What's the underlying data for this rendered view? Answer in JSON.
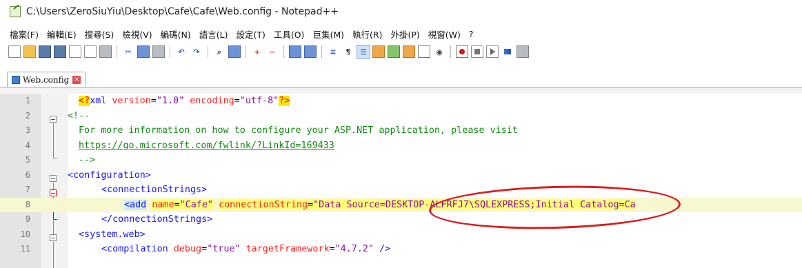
{
  "window": {
    "title": "C:\\Users\\ZeroSiuYiu\\Desktop\\Cafe\\Cafe\\Web.config - Notepad++"
  },
  "menu": {
    "items": [
      {
        "label": "檔案(F)"
      },
      {
        "label": "編輯(E)"
      },
      {
        "label": "搜尋(S)"
      },
      {
        "label": "檢視(V)"
      },
      {
        "label": "編碼(N)"
      },
      {
        "label": "語言(L)"
      },
      {
        "label": "設定(T)"
      },
      {
        "label": "工具(O)"
      },
      {
        "label": "巨集(M)"
      },
      {
        "label": "執行(R)"
      },
      {
        "label": "外掛(P)"
      },
      {
        "label": "視窗(W)"
      },
      {
        "label": "?"
      }
    ]
  },
  "toolbar": {
    "icons": [
      "new-file-icon",
      "open-file-icon",
      "save-icon",
      "save-all-icon",
      "close-icon",
      "close-all-icon",
      "print-icon",
      "cut-icon",
      "copy-icon",
      "paste-icon",
      "undo-icon",
      "redo-icon",
      "find-icon",
      "replace-icon",
      "zoom-in-icon",
      "zoom-out-icon",
      "sync-vertical-icon",
      "sync-horizontal-icon",
      "word-wrap-icon",
      "show-all-characters-icon",
      "indent-guide-icon",
      "user-defined-language-icon",
      "document-map-icon",
      "function-list-icon",
      "folder-as-workspace-icon",
      "monitoring-icon",
      "record-macro-icon",
      "stop-recording-icon",
      "playback-macro-icon",
      "run-macro-multiple-icon",
      "save-macro-icon"
    ]
  },
  "tab": {
    "label": "Web.config"
  },
  "editor": {
    "line_numbers": [
      "1",
      "2",
      "3",
      "4",
      "5",
      "6",
      "7",
      "8",
      "9",
      "10",
      "11"
    ],
    "lines": {
      "l1": {
        "open": "<?",
        "xml": "xml",
        "attr1": " version",
        "eq1": "=",
        "val1": "\"1.0\"",
        "attr2": " encoding",
        "eq2": "=",
        "val2": "\"utf-8\"",
        "close": "?>"
      },
      "l2": "<!--",
      "l3": "For more information on how to configure your ASP.NET application, please visit",
      "l4": "https://go.microsoft.com/fwlink/?LinkId=169433",
      "l5": "-->",
      "l6": "<configuration>",
      "l7": "<connectionStrings>",
      "l8": {
        "tag": "<add",
        "attr1": "name",
        "val1": "\"Cafe\"",
        "attr2": "connectionString",
        "val2a": "\"Data Source",
        "val2b": "=DESKTOP-ALFRFJ7\\SQLEXPRESS",
        "val2c": ";Initial Catalog=Ca"
      },
      "l9": "</connectionStrings>",
      "l10": "<system.web>",
      "l11": {
        "tag": "<compilation",
        "attr1": "debug",
        "val1": "\"true\"",
        "attr2": "targetFramework",
        "val2": "\"4.7.2\"",
        "close": " />"
      }
    }
  },
  "colors": {
    "annotation": "#d81f1f",
    "tag": "#1515ff",
    "attribute": "#ff2020",
    "value": "#8a0aa6",
    "comment": "#138a13"
  }
}
